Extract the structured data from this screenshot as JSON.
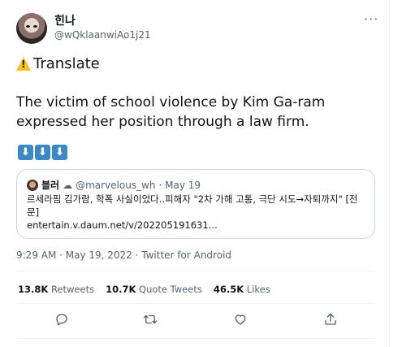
{
  "author": {
    "display_name": "힌나",
    "handle": "@wQklaanwiAo1j21"
  },
  "more_label": "···",
  "translate_label": "Translate",
  "tweet_text": "The victim of school violence by Kim Ga-ram expressed her position through a law firm.",
  "arrow_emojis": [
    "⬇",
    "⬇",
    "⬇"
  ],
  "quoted_tweet": {
    "display_name": "블러",
    "handle": "@marvelous_wh",
    "date": "· May 19",
    "text": "르세라핌 김가람, 학폭 사실이었다..피해자 \"2차 가해 고통, 극단 시도→자퇴까지\" [전문]",
    "link": "entertain.v.daum.net/v/202205191631..."
  },
  "timestamp": "9:29 AM · May 19, 2022 · Twitter for Android",
  "stats": {
    "retweets_count": "13.8K",
    "retweets_label": "Retweets",
    "quotes_count": "10.7K",
    "quotes_label": "Quote Tweets",
    "likes_count": "46.5K",
    "likes_label": "Likes"
  },
  "actions": [
    "reply-icon",
    "retweet-icon",
    "like-icon",
    "share-icon"
  ],
  "colors": {
    "text": "#0f1419",
    "secondary": "#536471",
    "border": "#cfd9de",
    "emoji_blue": "#3b88c3"
  }
}
